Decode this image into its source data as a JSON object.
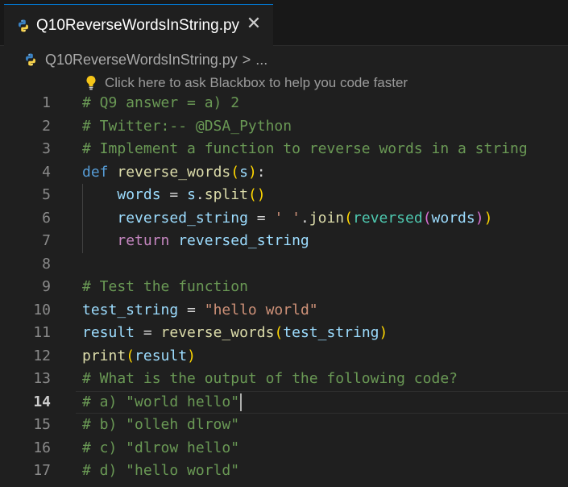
{
  "tab": {
    "title": "Q10ReverseWordsInString.py",
    "close_symbol": "✕"
  },
  "breadcrumb": {
    "file": "Q10ReverseWordsInString.py",
    "separator": ">",
    "more": "..."
  },
  "hint": {
    "text": "Click here to ask Blackbox to help you code faster"
  },
  "editor": {
    "current_line": 14,
    "lines": [
      {
        "n": "1",
        "tokens": [
          {
            "t": "# Q9 answer = a) 2",
            "c": "cm"
          }
        ]
      },
      {
        "n": "2",
        "tokens": [
          {
            "t": "# Twitter:-- @DSA_Python",
            "c": "cm"
          }
        ]
      },
      {
        "n": "3",
        "tokens": [
          {
            "t": "# Implement a function to reverse words in a string",
            "c": "cm"
          }
        ]
      },
      {
        "n": "4",
        "tokens": [
          {
            "t": "def ",
            "c": "kw"
          },
          {
            "t": "reverse_words",
            "c": "fn"
          },
          {
            "t": "(",
            "c": "p1"
          },
          {
            "t": "s",
            "c": "vr"
          },
          {
            "t": ")",
            "c": "p1"
          },
          {
            "t": ":",
            "c": "op"
          }
        ]
      },
      {
        "n": "5",
        "tokens": [
          {
            "t": "    ",
            "c": "op"
          },
          {
            "t": "words",
            "c": "vr"
          },
          {
            "t": " = ",
            "c": "op"
          },
          {
            "t": "s",
            "c": "vr"
          },
          {
            "t": ".",
            "c": "op"
          },
          {
            "t": "split",
            "c": "fn"
          },
          {
            "t": "()",
            "c": "p1"
          }
        ]
      },
      {
        "n": "6",
        "tokens": [
          {
            "t": "    ",
            "c": "op"
          },
          {
            "t": "reversed_string",
            "c": "vr"
          },
          {
            "t": " = ",
            "c": "op"
          },
          {
            "t": "' '",
            "c": "st"
          },
          {
            "t": ".",
            "c": "op"
          },
          {
            "t": "join",
            "c": "fn"
          },
          {
            "t": "(",
            "c": "p1"
          },
          {
            "t": "reversed",
            "c": "bi"
          },
          {
            "t": "(",
            "c": "p2"
          },
          {
            "t": "words",
            "c": "vr"
          },
          {
            "t": ")",
            "c": "p2"
          },
          {
            "t": ")",
            "c": "p1"
          }
        ]
      },
      {
        "n": "7",
        "tokens": [
          {
            "t": "    ",
            "c": "op"
          },
          {
            "t": "return ",
            "c": "ctl"
          },
          {
            "t": "reversed_string",
            "c": "vr"
          }
        ]
      },
      {
        "n": "8",
        "tokens": []
      },
      {
        "n": "9",
        "tokens": [
          {
            "t": "# Test the function",
            "c": "cm"
          }
        ]
      },
      {
        "n": "10",
        "tokens": [
          {
            "t": "test_string",
            "c": "vr"
          },
          {
            "t": " = ",
            "c": "op"
          },
          {
            "t": "\"hello world\"",
            "c": "st"
          }
        ]
      },
      {
        "n": "11",
        "tokens": [
          {
            "t": "result",
            "c": "vr"
          },
          {
            "t": " = ",
            "c": "op"
          },
          {
            "t": "reverse_words",
            "c": "fn"
          },
          {
            "t": "(",
            "c": "p1"
          },
          {
            "t": "test_string",
            "c": "vr"
          },
          {
            "t": ")",
            "c": "p1"
          }
        ]
      },
      {
        "n": "12",
        "tokens": [
          {
            "t": "print",
            "c": "fn"
          },
          {
            "t": "(",
            "c": "p1"
          },
          {
            "t": "result",
            "c": "vr"
          },
          {
            "t": ")",
            "c": "p1"
          }
        ]
      },
      {
        "n": "13",
        "tokens": [
          {
            "t": "# What is the output of the following code?",
            "c": "cm"
          }
        ]
      },
      {
        "n": "14",
        "tokens": [
          {
            "t": "# a) \"world hello\"",
            "c": "cm"
          }
        ]
      },
      {
        "n": "15",
        "tokens": [
          {
            "t": "# b) \"olleh dlrow\"",
            "c": "cm"
          }
        ]
      },
      {
        "n": "16",
        "tokens": [
          {
            "t": "# c) \"dlrow hello\"",
            "c": "cm"
          }
        ]
      },
      {
        "n": "17",
        "tokens": [
          {
            "t": "# d) \"hello world\"",
            "c": "cm"
          }
        ]
      }
    ]
  },
  "icons": {
    "file": "python-icon",
    "hint": "lightbulb-icon"
  },
  "colors": {
    "accent": "#0078d4",
    "python_blue": "#3b83c4",
    "python_yellow": "#f7d24a",
    "bulb": "#f5c518"
  }
}
